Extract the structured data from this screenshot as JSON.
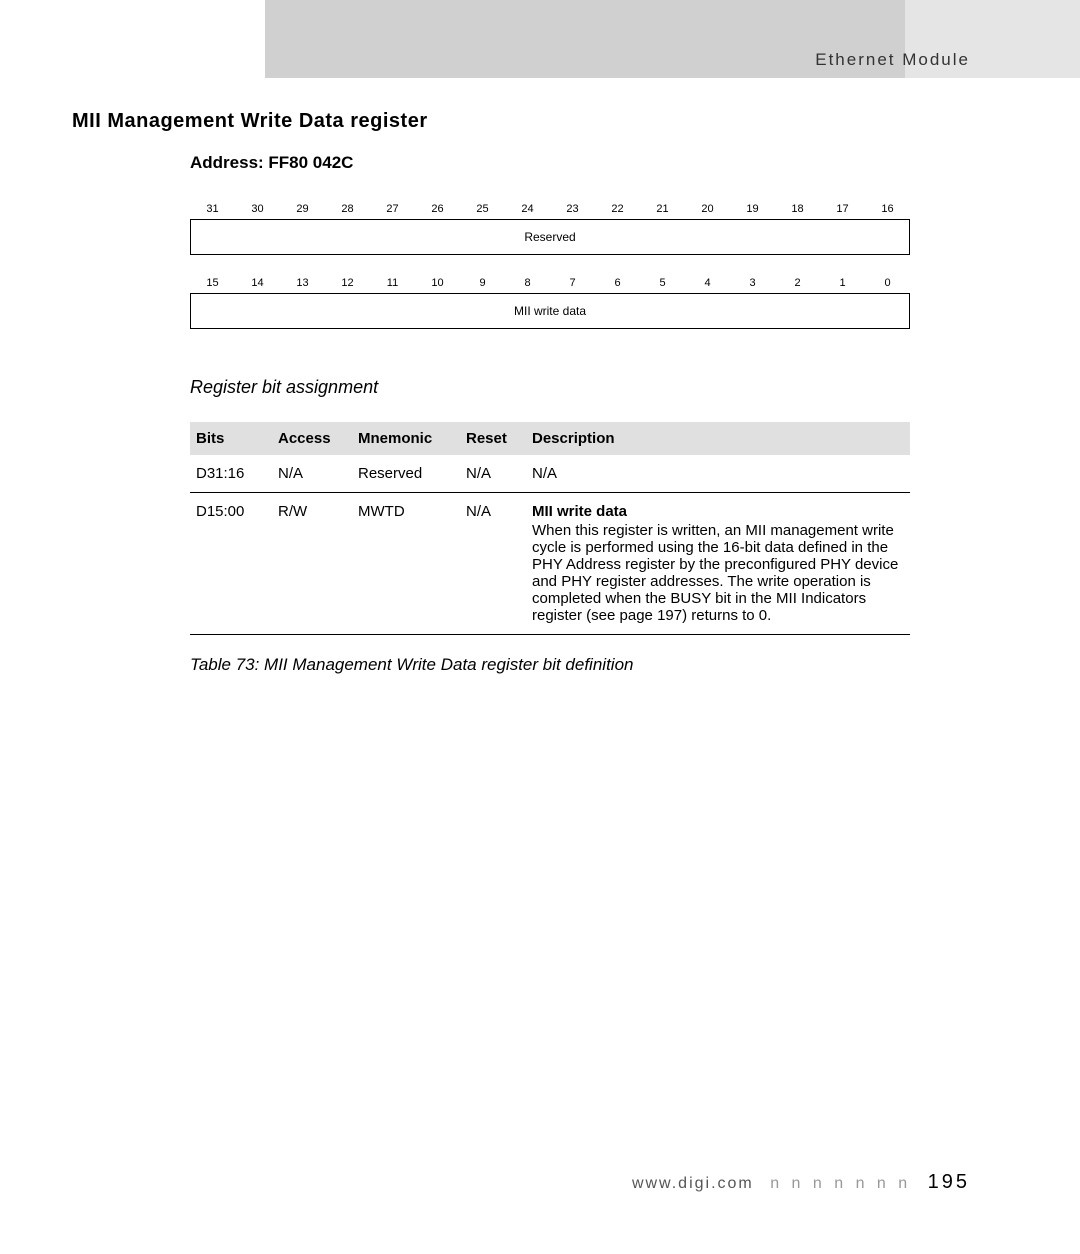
{
  "header": {
    "section": "Ethernet Module"
  },
  "title": "MII Management Write Data register",
  "address_label": "Address: FF80 042C",
  "bit_row_high": [
    "31",
    "30",
    "29",
    "28",
    "27",
    "26",
    "25",
    "24",
    "23",
    "22",
    "21",
    "20",
    "19",
    "18",
    "17",
    "16"
  ],
  "bit_box_high": "Reserved",
  "bit_row_low": [
    "15",
    "14",
    "13",
    "12",
    "11",
    "10",
    "9",
    "8",
    "7",
    "6",
    "5",
    "4",
    "3",
    "2",
    "1",
    "0"
  ],
  "bit_box_low": "MII write data",
  "subhead": "Register bit assignment",
  "table": {
    "headers": [
      "Bits",
      "Access",
      "Mnemonic",
      "Reset",
      "Description"
    ],
    "rows": [
      {
        "bits": "D31:16",
        "access": "N/A",
        "mnemonic": "Reserved",
        "reset": "N/A",
        "desc_title": "",
        "desc_body": "N/A"
      },
      {
        "bits": "D15:00",
        "access": "R/W",
        "mnemonic": "MWTD",
        "reset": "N/A",
        "desc_title": "MII write data",
        "desc_body": "When this register is written, an MII management write cycle is performed using the 16-bit data defined in the PHY Address register by the preconfigured PHY device and PHY register addresses. The write operation is completed when the BUSY bit in the MII Indicators register (see page 197) returns to 0."
      }
    ]
  },
  "caption": "Table 73: MII Management Write Data register bit definition",
  "footer": {
    "url": "www.digi.com",
    "sep": "n n n n n n n",
    "page": "195"
  }
}
